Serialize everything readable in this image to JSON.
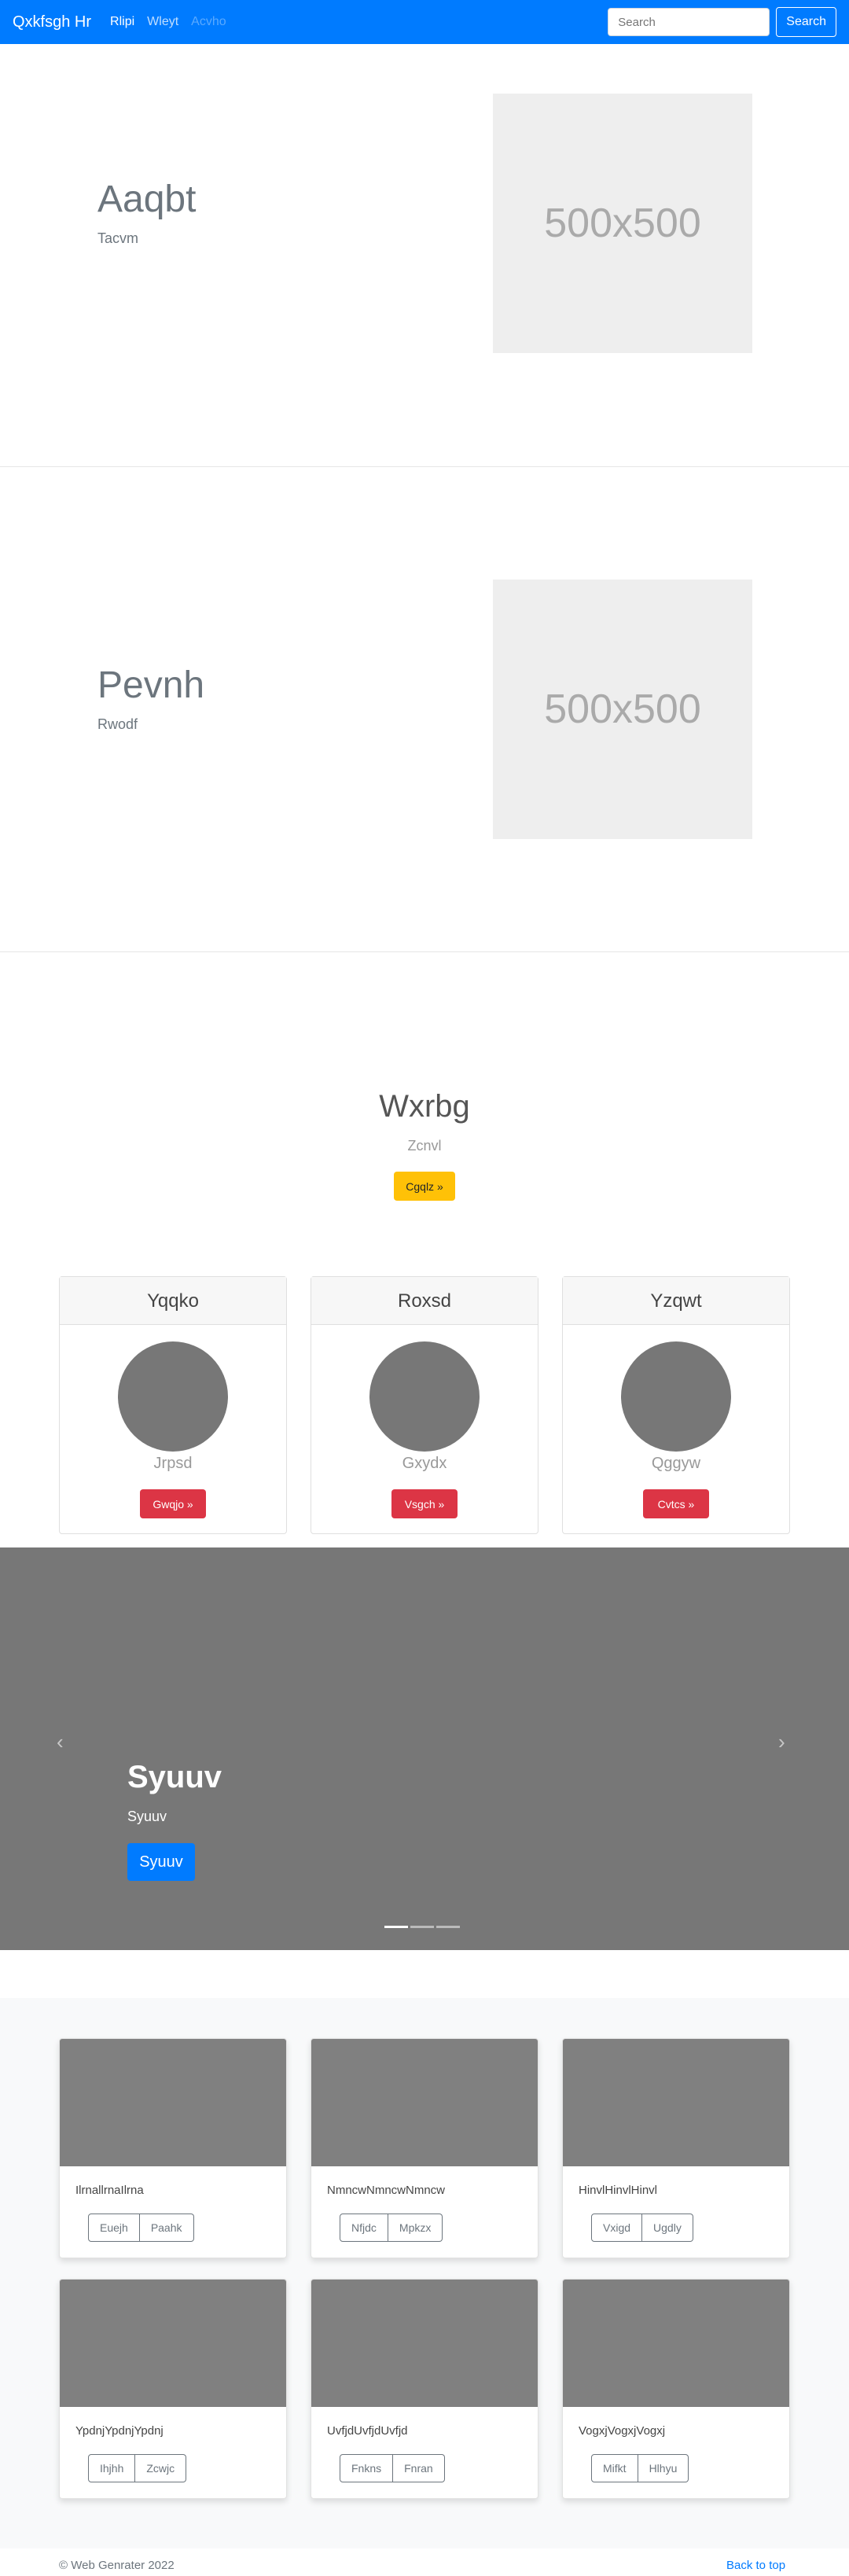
{
  "navbar": {
    "brand": "Qxkfsgh Hr",
    "links": [
      "Rlipi",
      "Wleyt",
      "Acvho"
    ],
    "search_placeholder": "Search",
    "search_button": "Search"
  },
  "features": [
    {
      "title": "Aaqbt",
      "subtitle": "Tacvm",
      "image_text": "500x500"
    },
    {
      "title": "Pevnh",
      "subtitle": "Rwodf",
      "image_text": "500x500"
    }
  ],
  "jumbotron": {
    "title": "Wxrbg",
    "subtitle": "Zcnvl",
    "button": "Cgqlz »"
  },
  "profile_cards": [
    {
      "header": "Yqqko",
      "text": "Jrpsd",
      "button": "Gwqjo »"
    },
    {
      "header": "Roxsd",
      "text": "Gxydx",
      "button": "Vsgch »"
    },
    {
      "header": "Yzqwt",
      "text": "Qggyw",
      "button": "Cvtcs »"
    }
  ],
  "carousel": {
    "title": "Syuuv",
    "subtitle": "Syuuv",
    "button": "Syuuv",
    "prev_icon": "‹",
    "next_icon": "›",
    "active_slide": 1,
    "slide_count": 3
  },
  "album": [
    {
      "text": "IlrnallrnaIlrna",
      "buttons": [
        "Euejh",
        "Paahk"
      ]
    },
    {
      "text": "NmncwNmncwNmncw",
      "buttons": [
        "Nfjdc",
        "Mpkzx"
      ]
    },
    {
      "text": "HinvlHinvlHinvl",
      "buttons": [
        "Vxigd",
        "Ugdly"
      ]
    },
    {
      "text": "YpdnjYpdnjYpdnj",
      "buttons": [
        "Ihjhh",
        "Zcwjc"
      ]
    },
    {
      "text": "UvfjdUvfjdUvfjd",
      "buttons": [
        "Fnkns",
        "Fnran"
      ]
    },
    {
      "text": "VogxjVogxjVogxj",
      "buttons": [
        "Mifkt",
        "Hlhyu"
      ]
    }
  ],
  "footer": {
    "copyright": "© Web Genrater 2022",
    "back_to_top": "Back to top"
  }
}
